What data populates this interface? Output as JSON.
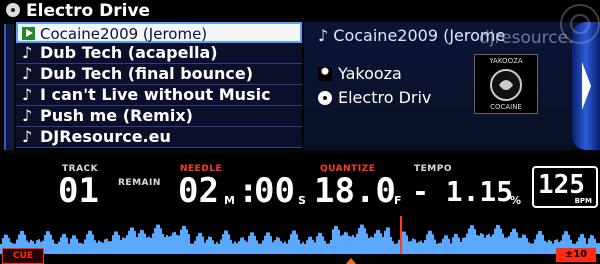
{
  "header": {
    "title": "Electro Drive",
    "icon": "disc-icon"
  },
  "tracks": [
    {
      "label": "Cocaine2009 (Jerome)",
      "selected": true
    },
    {
      "label": "Dub Tech (acapella)",
      "selected": false
    },
    {
      "label": "Dub Tech (final bounce)",
      "selected": false
    },
    {
      "label": "I can't Live without Music",
      "selected": false
    },
    {
      "label": "Push me (Remix)",
      "selected": false
    },
    {
      "label": "DJResource.eu",
      "selected": false
    }
  ],
  "info": {
    "title": "Cocaine2009 (Jerome",
    "artist": "Yakooza",
    "album": "Electro Driv",
    "art_top": "YAKOOZA",
    "art_bottom": "COCAINE",
    "watermark": "djresource.eu"
  },
  "status": {
    "track_label": "TRACK",
    "track_value": "01",
    "remain_label": "REMAIN",
    "needle_label": "NEEDLE",
    "minutes": "02",
    "m_unit": "M",
    "seconds": "00",
    "s_unit": "S",
    "quantize_label": "QUANTIZE",
    "frames": "18.0",
    "f_unit": "F",
    "tempo_label": "TEMPO",
    "tempo_value": "- 1.15",
    "tempo_unit": "%",
    "bpm_value": "125",
    "bpm_label": "BPM",
    "cue_label": "CUE",
    "range_label": "±10"
  },
  "colors": {
    "accent_red": "#ff3b1f",
    "wave_blue": "#5aa8ff",
    "list_bg": "#0b0f2a",
    "selected_bg": "#f4f6f8"
  }
}
